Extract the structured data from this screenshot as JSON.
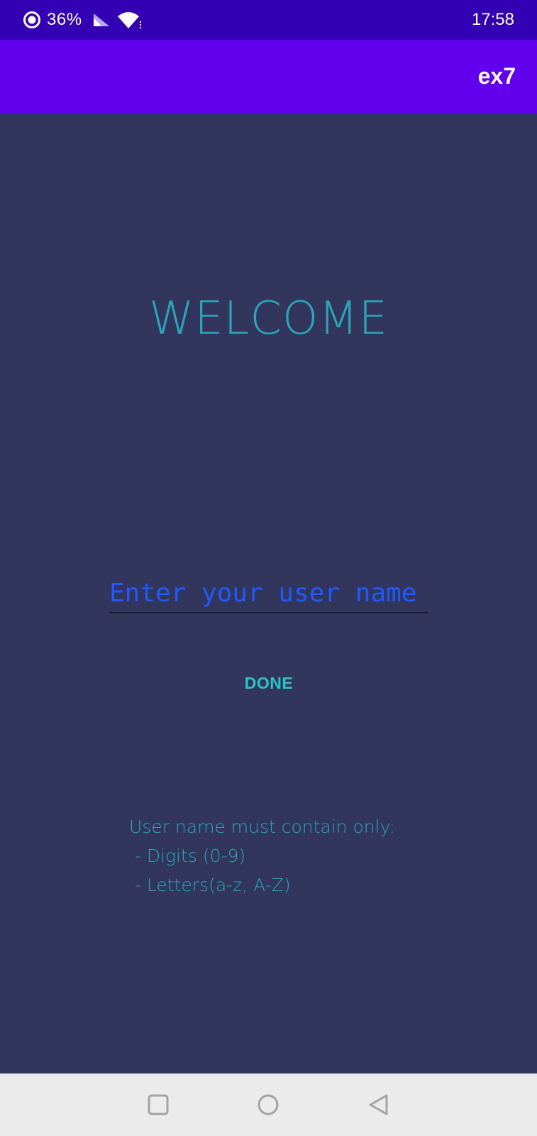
{
  "status_bar": {
    "battery_percent": "36%",
    "time": "17:58",
    "icons": [
      "battery-ring-icon",
      "signal-icon",
      "wifi-icon"
    ]
  },
  "app_bar": {
    "title": "ex7"
  },
  "main": {
    "welcome_text": "WELCOME",
    "username_placeholder": "Enter your user name",
    "username_value": "",
    "done_label": "DONE",
    "rules_title": "User name must contain only:",
    "rules_items": [
      " - Digits (0-9)",
      " - Letters(a-z, A-Z)"
    ]
  },
  "nav_bar": {
    "icons": [
      "recents-square-icon",
      "home-circle-icon",
      "back-triangle-icon"
    ]
  },
  "colors": {
    "status_bar": "#3300b3",
    "app_bar": "#6200ee",
    "background": "#33365c",
    "welcome_text": "#2aa6b9",
    "input_text": "#1e5bff",
    "done_button": "#2bc4c9",
    "nav_bar": "#ebebeb"
  }
}
